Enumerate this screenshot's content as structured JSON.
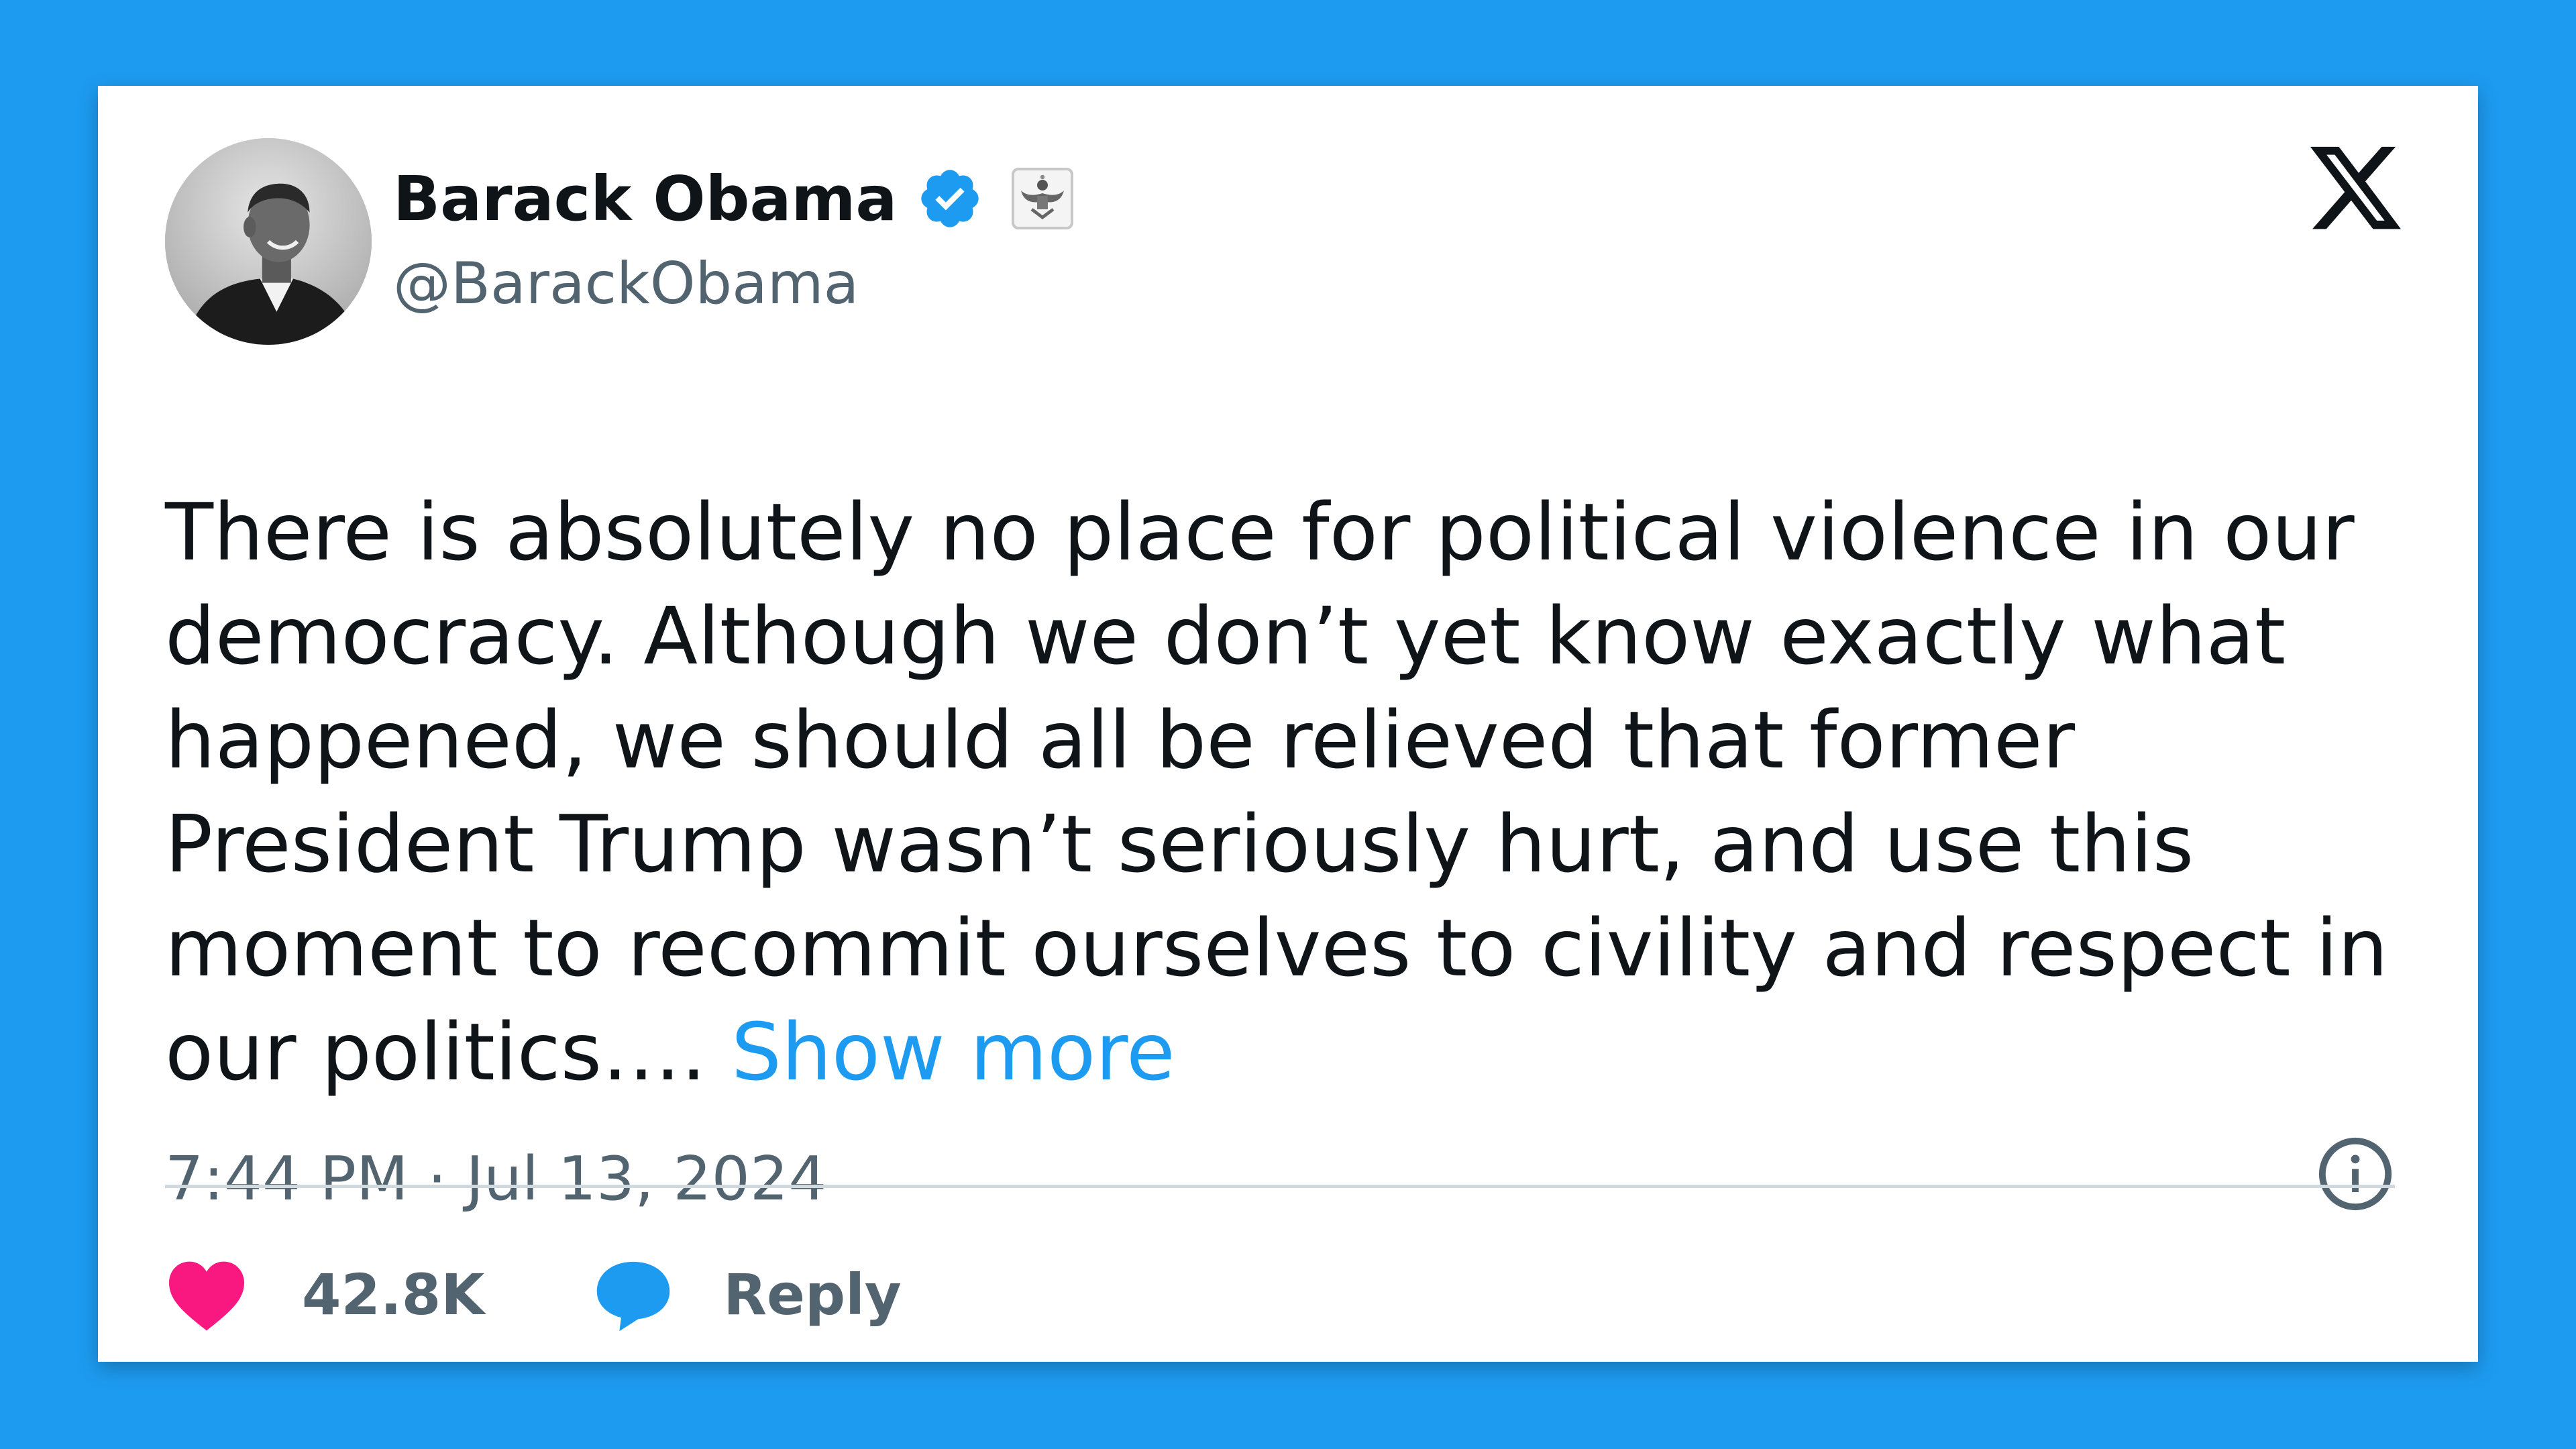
{
  "author": {
    "display_name": "Barack Obama",
    "handle": "@BarackObama",
    "verified": true,
    "affiliation_badge": "us-seal-icon",
    "avatar": "profile-photo"
  },
  "tweet": {
    "lines": [
      "There is absolutely no place for political violence in our",
      "democracy. Although we don’t yet know exactly what",
      "happened, we should all be relieved that former",
      "President Trump wasn’t seriously hurt, and use this",
      "moment to recommit ourselves to civility and respect in",
      "our politics…. "
    ],
    "show_more_label": "Show more",
    "timestamp": "7:44 PM · Jul 13, 2024"
  },
  "actions": {
    "like_count": "42.8K",
    "reply_label": "Reply"
  },
  "icons": {
    "platform_logo": "x-logo-icon",
    "info": "info-icon",
    "like": "heart-icon",
    "reply": "reply-bubble-icon",
    "verified": "verified-badge-icon"
  },
  "colors": {
    "background": "#1d9bf0",
    "card": "#ffffff",
    "text_primary": "#0f1419",
    "text_secondary": "#536471",
    "link": "#1d9bf0",
    "heart": "#f91880",
    "verified": "#1d9bf0"
  }
}
